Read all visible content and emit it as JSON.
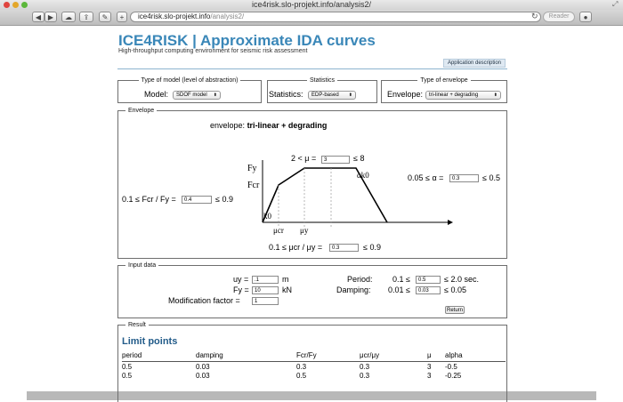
{
  "browser": {
    "window_title": "ice4risk.slo-projekt.info/analysis2/",
    "url_host": "ice4risk.slo-projekt.info",
    "url_path": "/analysis2/",
    "reader_label": "Reader",
    "back_glyph": "◀",
    "forward_glyph": "▶",
    "add_glyph": "+",
    "wrench_glyph": "✎",
    "cloud_glyph": "☁",
    "share_glyph": "⇪",
    "reload_glyph": "↻",
    "stop_glyph": "●",
    "fullscreen_glyph": "⤢"
  },
  "header": {
    "title": "ICE4RISK | Approximate IDA curves",
    "subtitle": "High-throughput computing environment for seismic risk assessment",
    "app_description_label": "Application description"
  },
  "model": {
    "legend": "Type of model (level of abstraction)",
    "label": "Model:",
    "value": "SDOF model"
  },
  "statistics": {
    "legend": "Statistics",
    "label": "Statistics:",
    "value": "EDP-based"
  },
  "envelope_type": {
    "legend": "Type of envelope",
    "label": "Envelope:",
    "value": "tri-linear + degrading"
  },
  "envelope": {
    "legend": "Envelope",
    "envelope_label": "envelope:",
    "envelope_value": "tri-linear + degrading",
    "mu_prefix": "2 < μ =",
    "mu_value": "3",
    "mu_suffix": "≤ 8",
    "fcr_prefix": "0.1 ≤ Fcr / Fy =",
    "fcr_value": "0.4",
    "fcr_suffix": "≤ 0.9",
    "alpha_prefix": "0.05 ≤ α =",
    "alpha_value": "0.3",
    "alpha_suffix": "≤ 0.5",
    "mucr_prefix": "0.1 ≤ μcr / μy =",
    "mucr_value": "0.3",
    "mucr_suffix": "≤ 0.9",
    "plot_labels": {
      "fy": "Fy",
      "fcr": "Fcr",
      "k0": "k0",
      "alpha_k0": "αk0",
      "mu_cr": "μcr",
      "mu_y": "μy"
    }
  },
  "input_data": {
    "legend": "Input data",
    "uy_label": "uy =",
    "uy_value": ".1",
    "uy_unit": "m",
    "fy_label": "Fy =",
    "fy_value": "10",
    "fy_unit": "kN",
    "modification_label": "Modification factor =",
    "modification_value": "1",
    "period_label": "Period:",
    "period_prefix": "0.1 ≤",
    "period_value": "0.5",
    "period_suffix": "≤ 2.0 sec.",
    "damping_label": "Damping:",
    "damping_prefix": "0.01 ≤",
    "damping_value": "0.03",
    "damping_suffix": "≤ 0.05",
    "return_label": "Return"
  },
  "result": {
    "legend": "Result",
    "limit_points_title": "Limit points",
    "columns": [
      "period",
      "damping",
      "Fcr/Fy",
      "μcr/μy",
      "μ",
      "alpha"
    ],
    "rows": [
      [
        "0.5",
        "0.03",
        "0.3",
        "0.3",
        "3",
        "-0.5"
      ],
      [
        "0.5",
        "0.03",
        "0.5",
        "0.3",
        "3",
        "-0.25"
      ]
    ]
  }
}
